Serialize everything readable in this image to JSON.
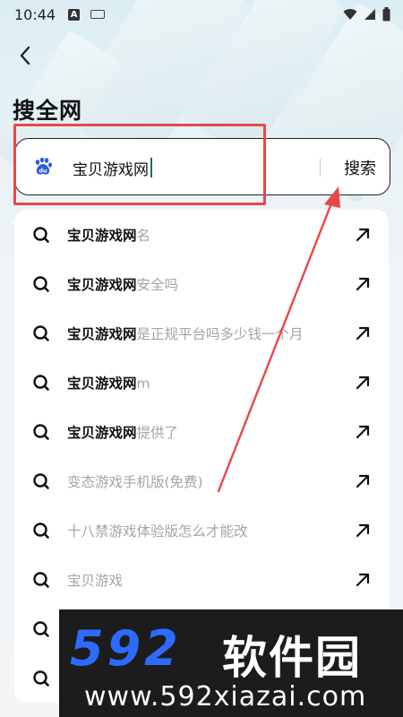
{
  "status_bar": {
    "time": "10:44",
    "notif_letter": "A"
  },
  "page": {
    "title": "搜全网"
  },
  "search": {
    "engine_icon": "baidu-paw-icon",
    "query": "宝贝游戏网",
    "button_label": "搜索"
  },
  "suggestions": [
    {
      "bold": "宝贝游戏网",
      "rest": "名"
    },
    {
      "bold": "宝贝游戏网",
      "rest": "安全吗"
    },
    {
      "bold": "宝贝游戏网",
      "rest": "是正规平台吗多少钱一个月"
    },
    {
      "bold": "宝贝游戏网",
      "rest": "m"
    },
    {
      "bold": "宝贝游戏网",
      "rest": "提供了"
    },
    {
      "bold": "",
      "rest": "变态游戏手机版(免费)"
    },
    {
      "bold": "",
      "rest": "十八禁游戏体验版怎么才能改"
    },
    {
      "bold": "",
      "rest": "宝贝游戏"
    },
    {
      "bold": "",
      "rest": ""
    },
    {
      "bold": "",
      "rest": ""
    }
  ],
  "watermark": {
    "logo": "592",
    "cn_name": "软件园",
    "url": "www.592xiazai.com"
  },
  "colors": {
    "annotation_red": "#e8474a",
    "baidu_blue": "#2b5fd9",
    "caret_green": "#1d6b52"
  }
}
